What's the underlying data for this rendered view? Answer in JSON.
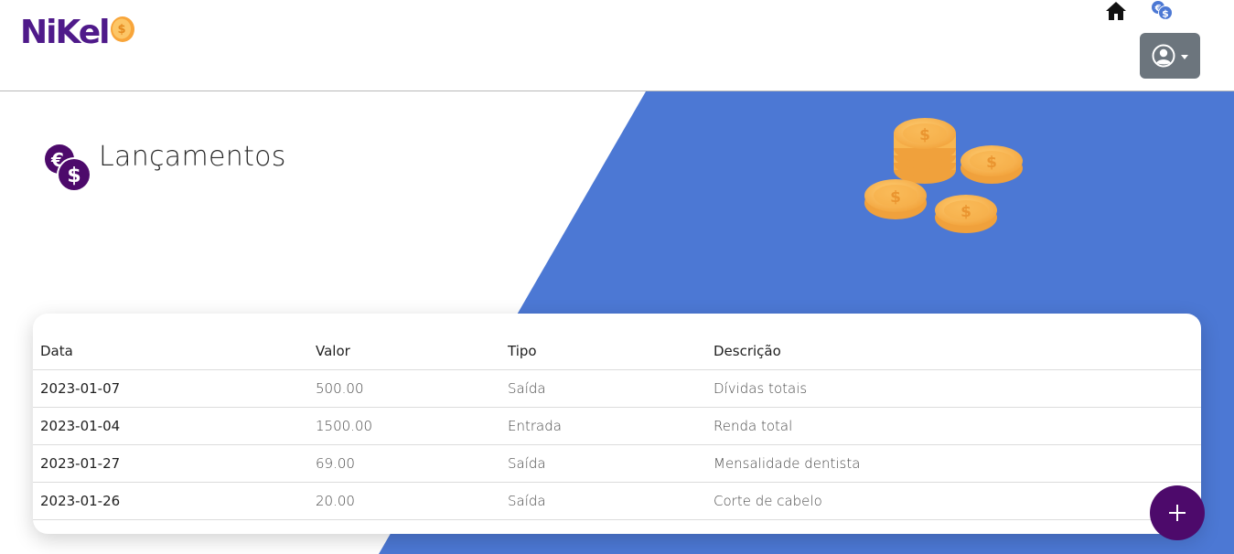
{
  "header": {
    "logo_text": "NiKel",
    "user_menu_icon": "user-circle-icon",
    "home_icon": "home-icon",
    "transactions_icon": "currency-icon"
  },
  "main": {
    "title": "Lançamentos",
    "title_icon": "currency-icon"
  },
  "table": {
    "headers": [
      "Data",
      "Valor",
      "Tipo",
      "Descrição"
    ],
    "rows": [
      {
        "date": "2023-01-07",
        "value": "500.00",
        "type": "Saída",
        "description": "Dívidas totais"
      },
      {
        "date": "2023-01-04",
        "value": "1500.00",
        "type": "Entrada",
        "description": "Renda total"
      },
      {
        "date": "2023-01-27",
        "value": "69.00",
        "type": "Saída",
        "description": "Mensalidade dentista"
      },
      {
        "date": "2023-01-26",
        "value": "20.00",
        "type": "Saída",
        "description": "Corte de cabelo"
      }
    ]
  },
  "fab": {
    "icon": "plus-icon"
  },
  "colors": {
    "brand_purple": "#4d0a6b",
    "accent_blue": "#4c78d4",
    "gray_button": "#6c757d",
    "coin_gold": "#f6b54a"
  }
}
